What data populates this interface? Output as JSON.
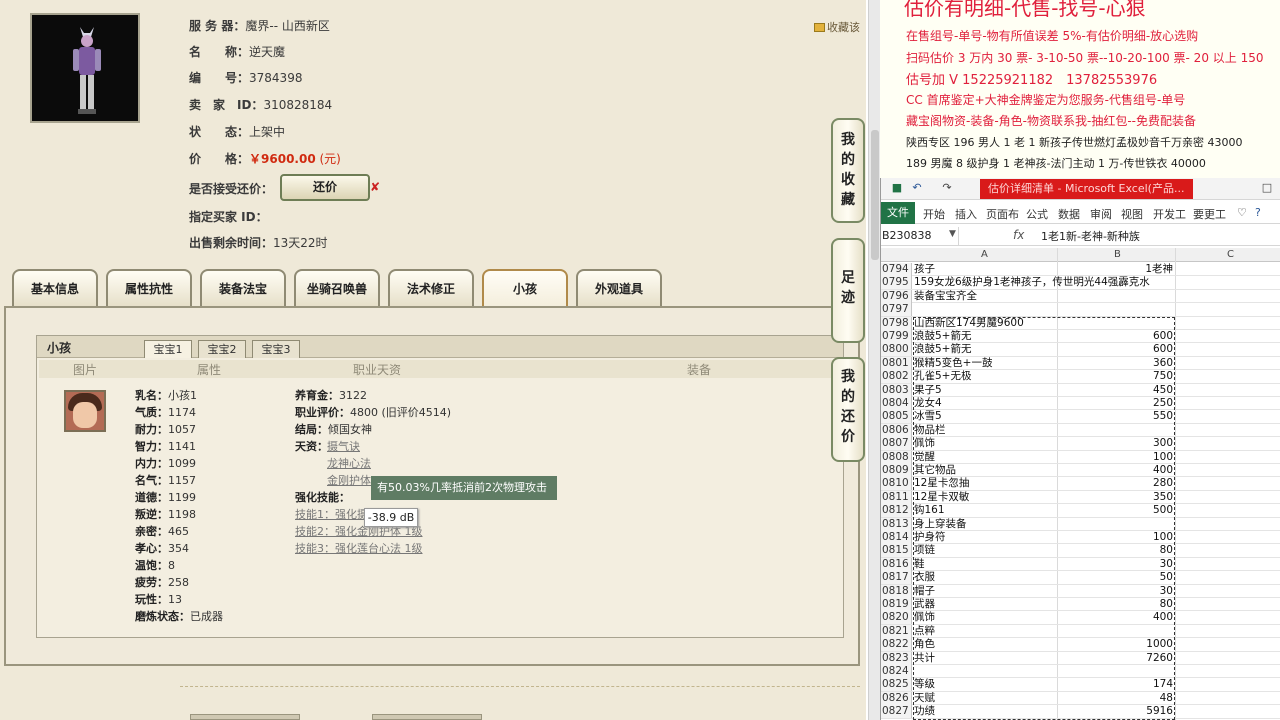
{
  "game": {
    "fav_label": "收藏该",
    "info": [
      {
        "label": "服 务 器：",
        "value": "魔界-- 山西新区"
      },
      {
        "label": "名　　称：",
        "value": "逆天魔"
      },
      {
        "label": "编　　号：",
        "value": "3784398"
      },
      {
        "label": "卖　家　ID：",
        "value": "310828184"
      },
      {
        "label": "状　　态：",
        "value": "上架中"
      }
    ],
    "price_label": "价　　格：",
    "price_value": "￥9600.00",
    "price_unit": " (元)",
    "bargain_label": "是否接受还价：",
    "bargain_button": "还价",
    "bargain_x": "✘",
    "buyer_label": "指定买家 ID：",
    "time_label": "出售剩余时间：",
    "time_value": "13天22时",
    "tabs": [
      "基本信息",
      "属性抗性",
      "装备法宝",
      "坐骑召唤兽",
      "法术修正",
      "小孩",
      "外观道具"
    ],
    "subpanel_title": "小孩",
    "subtabs": [
      "宝宝1",
      "宝宝2",
      "宝宝3"
    ],
    "columns": [
      "图片",
      "属性",
      "职业天资",
      "装备"
    ],
    "child_attrs": [
      {
        "k": "乳名：",
        "v": "小孩1"
      },
      {
        "k": "气质：",
        "v": "1174"
      },
      {
        "k": "耐力：",
        "v": "1057"
      },
      {
        "k": "智力：",
        "v": "1141"
      },
      {
        "k": "内力：",
        "v": "1099"
      },
      {
        "k": "名气：",
        "v": "1157"
      },
      {
        "k": "道德：",
        "v": "1199"
      },
      {
        "k": "叛逆：",
        "v": "1198"
      },
      {
        "k": "亲密：",
        "v": "465"
      },
      {
        "k": "孝心：",
        "v": "354"
      },
      {
        "k": "温饱：",
        "v": "8"
      },
      {
        "k": "疲劳：",
        "v": "258"
      },
      {
        "k": "玩性：",
        "v": "13"
      },
      {
        "k": "磨炼状态：",
        "v": "已成器"
      }
    ],
    "career": {
      "foster_label": "养育金：",
      "foster": "3122",
      "rating_label": "职业评价：",
      "rating": "4800 (旧评价4514)",
      "ending_label": "结局：",
      "ending": "倾国女神",
      "talent_label": "天资：",
      "talents": [
        "摄气诀",
        "龙神心法",
        "金刚护体"
      ],
      "skill_label": "强化技能：",
      "skills": [
        "技能1：强化摄气诀 1级",
        "技能2：强化金刚护体 1级",
        "技能3：强化莲台心法 1级"
      ]
    },
    "tooltip": "有50.03%几率抵消前2次物理攻击",
    "db_tip": "-38.9 dB",
    "side_buttons": [
      [
        "我",
        "的",
        "收",
        "藏"
      ],
      [
        "足",
        "迹"
      ],
      [
        "我",
        "的",
        "还",
        "价"
      ]
    ]
  },
  "note": {
    "title": "估价有明细-代售-找号-心狠",
    "lines": [
      "在售组号-单号-物有所值误差 5%-有估价明细-放心选购",
      "扫码估价 3 万内 30 票- 3-10-50 票--10-20-100 票- 20 以上 150",
      "估号加 V 15225921182　13782553976",
      "CC 首席鉴定+大神金牌鉴定为您服务-代售组号-单号",
      "藏宝阁物资-装备-角色-物资联系我-抽红包--免费配装备",
      "陕西专区 196 男人 1 老 1 新孩子传世燃灯孟极妙音千万亲密 43000",
      "189 男魔 8 级护身 1 老神孩-法门主动 1 万-传世铁衣 40000"
    ]
  },
  "excel": {
    "title": "估价详细清单 - Microsoft Excel(产品...",
    "file_tab": "文件",
    "ribbon_tabs": [
      "开始",
      "插入",
      "页面布",
      "公式",
      "数据",
      "审阅",
      "视图",
      "开发工",
      "要更工"
    ],
    "name_box": "B230838",
    "fx": "fx",
    "formula": "1老1新-老神-新种族",
    "col_headers": [
      "A",
      "B",
      "C"
    ],
    "rows": [
      {
        "n": "0794",
        "a": "孩子",
        "b": "1老神"
      },
      {
        "n": "0795",
        "a": "159女龙6级护身1老神孩子，传世明光44强霹克水",
        "b": ""
      },
      {
        "n": "0796",
        "a": "装备宝宝齐全",
        "b": ""
      },
      {
        "n": "0797",
        "a": "",
        "b": ""
      },
      {
        "n": "0798",
        "a": "山西新区174男魔9600",
        "b": ""
      },
      {
        "n": "0799",
        "a": "浪鼓5+箭无",
        "b": "600"
      },
      {
        "n": "0800",
        "a": "浪鼓5+箭无",
        "b": "600"
      },
      {
        "n": "0801",
        "a": "猴精5变色+一鼓",
        "b": "360"
      },
      {
        "n": "0802",
        "a": "孔雀5+无极",
        "b": "750"
      },
      {
        "n": "0803",
        "a": "果子5",
        "b": "450"
      },
      {
        "n": "0804",
        "a": "龙女4",
        "b": "250"
      },
      {
        "n": "0805",
        "a": "冰雪5",
        "b": "550"
      },
      {
        "n": "0806",
        "a": "物品栏",
        "b": ""
      },
      {
        "n": "0807",
        "a": "佩饰",
        "b": "300"
      },
      {
        "n": "0808",
        "a": "觉醒",
        "b": "100"
      },
      {
        "n": "0809",
        "a": "其它物品",
        "b": "400"
      },
      {
        "n": "0810",
        "a": "12星卡忽抽",
        "b": "280"
      },
      {
        "n": "0811",
        "a": "12星卡双敏",
        "b": "350"
      },
      {
        "n": "0812",
        "a": "钩161",
        "b": "500"
      },
      {
        "n": "0813",
        "a": "身上穿装备",
        "b": ""
      },
      {
        "n": "0814",
        "a": "护身符",
        "b": "100"
      },
      {
        "n": "0815",
        "a": "项链",
        "b": "80"
      },
      {
        "n": "0816",
        "a": "鞋",
        "b": "30"
      },
      {
        "n": "0817",
        "a": "衣服",
        "b": "50"
      },
      {
        "n": "0818",
        "a": "帽子",
        "b": "30"
      },
      {
        "n": "0819",
        "a": "武器",
        "b": "80"
      },
      {
        "n": "0820",
        "a": "佩饰",
        "b": "400"
      },
      {
        "n": "0821",
        "a": "点粹",
        "b": ""
      },
      {
        "n": "0822",
        "a": "角色",
        "b": "1000"
      },
      {
        "n": "0823",
        "a": "共计",
        "b": "7260"
      },
      {
        "n": "0824",
        "a": "",
        "b": ""
      },
      {
        "n": "0825",
        "a": "等级",
        "b": "174"
      },
      {
        "n": "0826",
        "a": "天赋",
        "b": "48"
      },
      {
        "n": "0827",
        "a": "功绩",
        "b": "5916"
      }
    ]
  }
}
